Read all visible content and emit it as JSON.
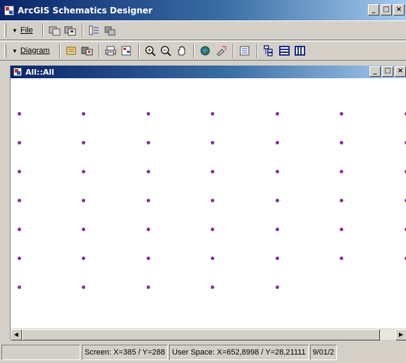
{
  "window": {
    "title": "ArcGIS Schematics Designer",
    "controls": [
      "_",
      "□",
      "×"
    ]
  },
  "toolbar_file": {
    "menu_label": "File",
    "buttons": [
      "open-diagram-icon",
      "save-diagram-icon",
      "dataset-icon",
      "properties-icon"
    ]
  },
  "toolbar_diagram": {
    "menu_label": "Diagram",
    "buttons": [
      "edit-diagram-icon",
      "update-diagram-icon",
      "print-icon",
      "export-icon",
      "zoom-in-icon",
      "zoom-out-icon",
      "pan-icon",
      "full-extent-icon",
      "select-icon",
      "list-icon",
      "tree-layout-icon",
      "horizontal-layout-icon",
      "vertical-layout-icon"
    ]
  },
  "child_window": {
    "title": "All::All",
    "controls": [
      "_",
      "□",
      "×"
    ]
  },
  "canvas": {
    "dot_color": "#8b2b9b",
    "dot_rows": [
      7,
      7,
      7,
      7,
      7,
      7,
      5
    ]
  },
  "statusbar": {
    "panel1": "",
    "screen": "Screen: X=385 / Y=288",
    "user_space": "User Space: X=652,8998 / Y=28,21111",
    "date": "9/01/2"
  }
}
